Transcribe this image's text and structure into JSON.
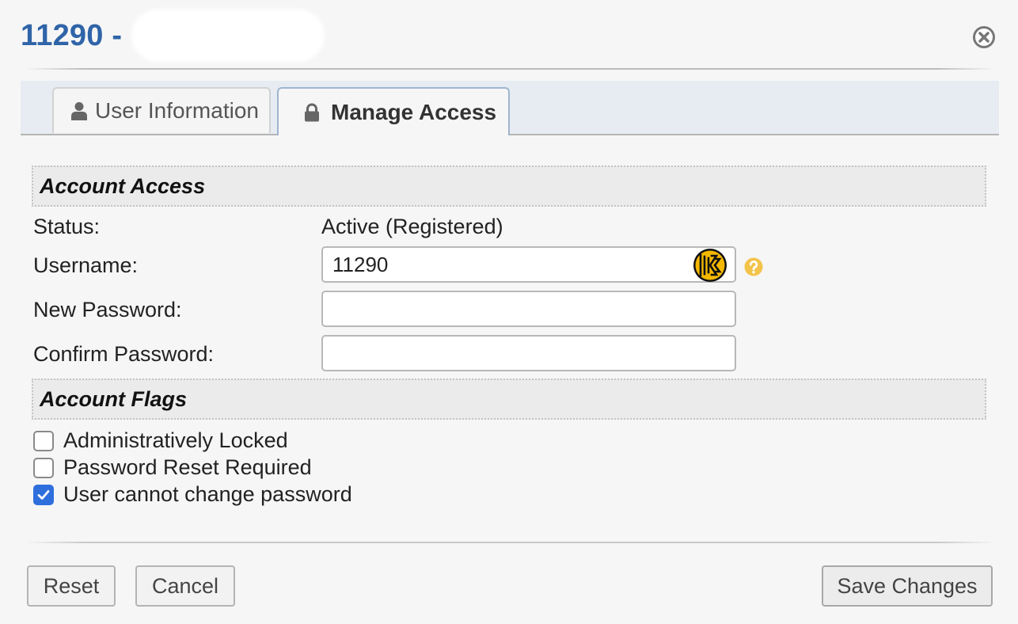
{
  "dialog": {
    "title": "11290 - "
  },
  "tabs": [
    {
      "label": "User Information",
      "icon": "user-icon"
    },
    {
      "label": "Manage Access",
      "icon": "lock-icon"
    }
  ],
  "account_access": {
    "heading": "Account Access",
    "status_label": "Status:",
    "status_value": "Active (Registered)",
    "username_label": "Username:",
    "username_value": "11290",
    "new_password_label": "New Password:",
    "new_password_value": "",
    "confirm_password_label": "Confirm Password:",
    "confirm_password_value": ""
  },
  "account_flags": {
    "heading": "Account Flags",
    "flags": [
      {
        "label": "Administratively Locked",
        "checked": false
      },
      {
        "label": "Password Reset Required",
        "checked": false
      },
      {
        "label": "User cannot change password",
        "checked": true
      }
    ]
  },
  "buttons": {
    "reset": "Reset",
    "cancel": "Cancel",
    "save": "Save Changes"
  },
  "colors": {
    "title": "#2f64a8",
    "checkbox_checked": "#2f6fdd",
    "help_icon": "#f3c34a",
    "keeper_icon": "#f5b800"
  }
}
